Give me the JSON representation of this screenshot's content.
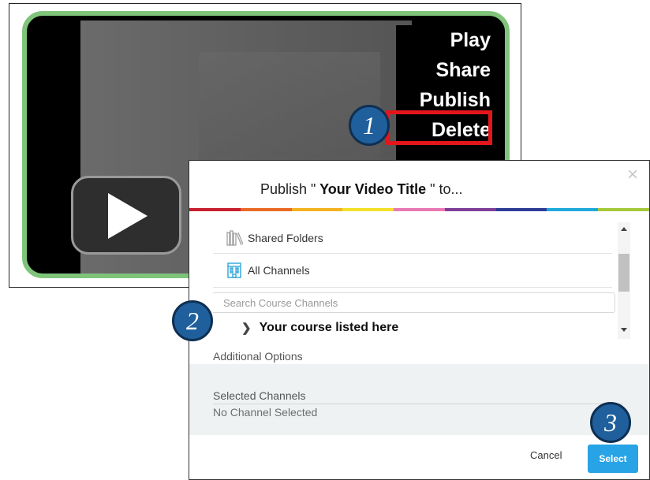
{
  "context_menu": {
    "items": [
      "Play",
      "Share",
      "Publish",
      "Delete"
    ]
  },
  "callouts": {
    "step1": "1",
    "step2": "2",
    "step3": "3"
  },
  "dialog": {
    "title_prefix": "Publish \"",
    "title_video": " Your Video Title ",
    "title_suffix": "\" to...",
    "close_symbol": "×",
    "rainbow_colors": [
      "#c8202f",
      "#e96a25",
      "#f4b223",
      "#f2e02a",
      "#e979b4",
      "#7c3f98",
      "#2d3d96",
      "#1fa9dc",
      "#a6c93b"
    ],
    "folders": [
      {
        "label": "Shared Folders",
        "icon": "shared-folders-icon"
      },
      {
        "label": "All Channels",
        "icon": "channels-icon"
      }
    ],
    "search": {
      "placeholder": "Search Course Channels"
    },
    "course": {
      "label": "Your course listed here"
    },
    "additional_options": "Additional Options",
    "selected_channels": {
      "title": "Selected Channels",
      "empty": "No Channel Selected"
    },
    "cancel_label": "Cancel",
    "select_label": "Select"
  },
  "colors": {
    "accent": "#27a3e6",
    "highlight": "#e4161c",
    "player_border": "#7fc47a",
    "badge": "#1f5f9c"
  }
}
